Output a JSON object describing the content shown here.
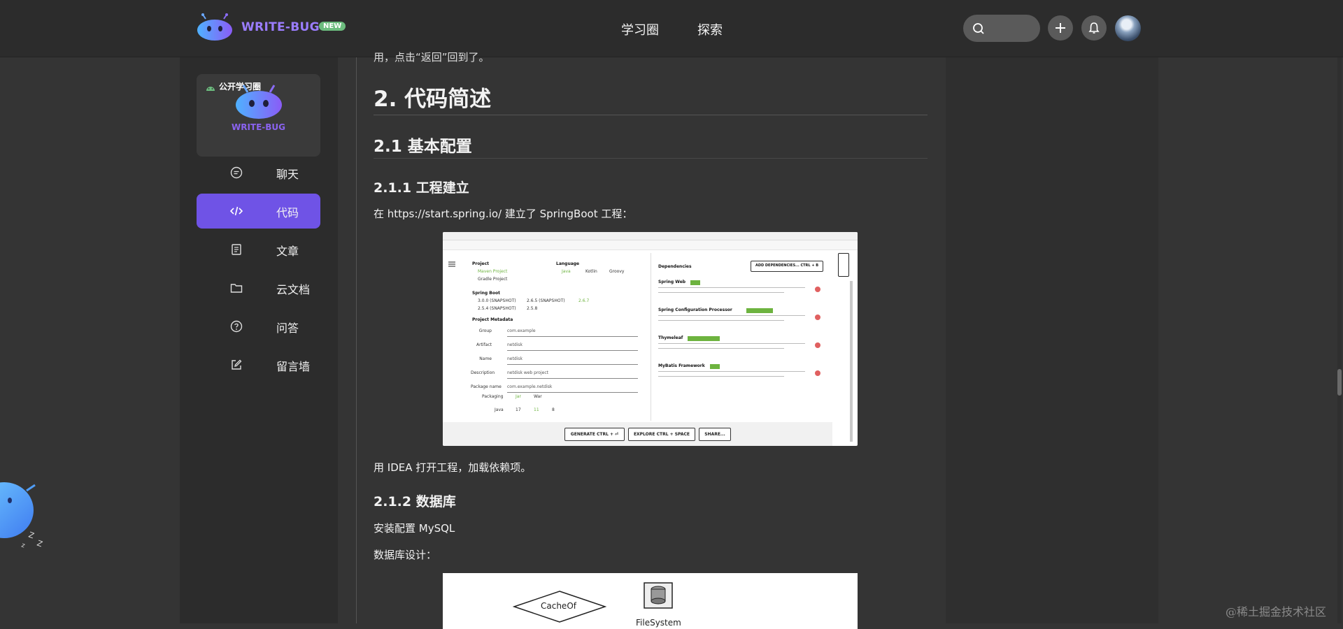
{
  "header": {
    "brand": "WRITE-BUG",
    "badge": "NEW",
    "nav": [
      "学习圈",
      "探索"
    ]
  },
  "sidebar": {
    "card_label": "公开学习圈",
    "card_brand": "WRITE-BUG",
    "items": [
      {
        "label": "聊天",
        "icon": "chat-icon",
        "active": false
      },
      {
        "label": "代码",
        "icon": "code-icon",
        "active": true
      },
      {
        "label": "文章",
        "icon": "article-icon",
        "active": false
      },
      {
        "label": "云文档",
        "icon": "folder-icon",
        "active": false
      },
      {
        "label": "问答",
        "icon": "question-icon",
        "active": false
      },
      {
        "label": "留言墙",
        "icon": "edit-icon",
        "active": false
      }
    ]
  },
  "article": {
    "partial_line": "用，点击“返回”回到了。",
    "h1": "2. 代码简述",
    "h2": "2.1 基本配置",
    "h3_project": "2.1.1 工程建立",
    "p_spring": "在 https://start.spring.io/ 建立了 SpringBoot 工程：",
    "p_idea": "用 IDEA 打开工程，加载依赖项。",
    "h3_db": "2.1.2 数据库",
    "p_mysql": "安装配置 MySQL",
    "p_dbdesign": "数据库设计："
  },
  "spring_screenshot": {
    "project_title": "Project",
    "project_opts": [
      "Maven Project",
      "Gradle Project"
    ],
    "language_title": "Language",
    "language_opts": [
      "Java",
      "Kotlin",
      "Groovy"
    ],
    "boot_title": "Spring Boot",
    "boot_opts": [
      "3.0.0 (SNAPSHOT)",
      "2.6.5 (SNAPSHOT)",
      "2.6.7",
      "2.5.4 (SNAPSHOT)",
      "2.5.8"
    ],
    "metadata_title": "Project Metadata",
    "metadata": [
      {
        "label": "Group",
        "value": "com.example"
      },
      {
        "label": "Artifact",
        "value": "netdisk"
      },
      {
        "label": "Name",
        "value": "netdisk"
      },
      {
        "label": "Description",
        "value": "netdisk web project"
      },
      {
        "label": "Package name",
        "value": "com.example.netdisk"
      }
    ],
    "packaging_label": "Packaging",
    "packaging_opts": [
      "Jar",
      "War"
    ],
    "java_label": "Java",
    "java_opts": [
      "17",
      "11",
      "8"
    ],
    "deps_title": "Dependencies",
    "add_deps": "ADD DEPENDENCIES... CTRL + B",
    "deps": [
      {
        "name": "Spring Web",
        "tag": "WEB"
      },
      {
        "name": "Spring Configuration Processor",
        "tag": "DEVELOPER TOOLS"
      },
      {
        "name": "Thymeleaf",
        "tag": "TEMPLATE ENGINES"
      },
      {
        "name": "MyBatis Framework",
        "tag": "SQL"
      }
    ],
    "buttons": [
      "GENERATE CTRL + ⏎",
      "EXPLORE CTRL + SPACE",
      "SHARE..."
    ]
  },
  "diagram": {
    "nodes": [
      "CacheOf",
      "FileSystem"
    ]
  },
  "watermark": "@稀土掘金技术社区",
  "colors": {
    "accent": "#6f53e6",
    "header_bg": "#2c2c2c",
    "content_bg": "#343434",
    "badge": "#6cbc7e",
    "brand_text": "#9b7dff"
  }
}
